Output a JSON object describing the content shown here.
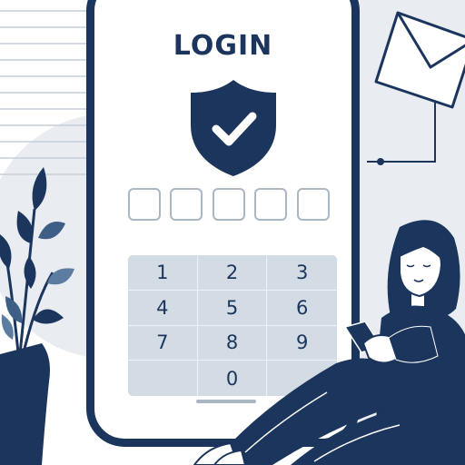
{
  "login": {
    "title": "LOGIN",
    "code_boxes": 5
  },
  "keypad": {
    "keys": [
      "1",
      "2",
      "3",
      "4",
      "5",
      "6",
      "7",
      "8",
      "9",
      "",
      "0",
      ""
    ]
  },
  "colors": {
    "navy": "#1b355c",
    "light_gray": "#d3dbe4",
    "pale_gray": "#eef1f5",
    "white": "#ffffff"
  },
  "icons": [
    "shield-check-icon",
    "envelope-icon",
    "plant-illustration",
    "woman-with-phone-illustration"
  ]
}
